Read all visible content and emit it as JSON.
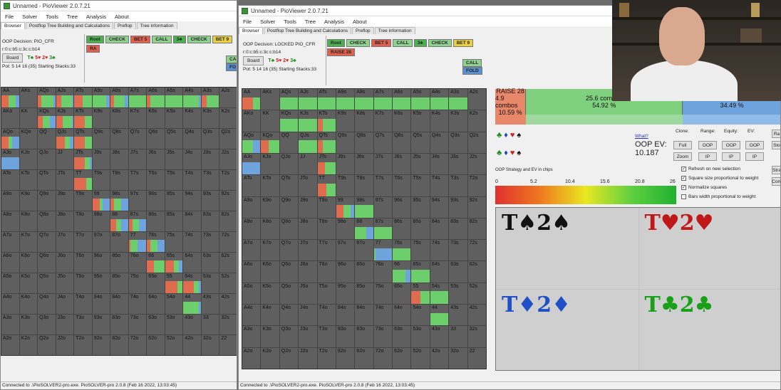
{
  "left_window": {
    "title": "Unnamed - PioViewer 2.0.7.21",
    "menu": [
      "File",
      "Solver",
      "Tools",
      "Tree",
      "Analysis",
      "About"
    ],
    "tabs": [
      "Browser",
      "Postflop Tree Building and Calculations",
      "Preflop",
      "Tree information"
    ],
    "decision": "OOP Decision:  PIO_CFR",
    "line": "r:0:c:b5:c:3c:c:b14",
    "board_label": "Board",
    "board_cards": [
      {
        "t": "T♣",
        "c": "#1a8a1a"
      },
      {
        "t": "5♥",
        "c": "#d02020"
      },
      {
        "t": "2♥",
        "c": "#d02020"
      },
      {
        "t": "3♣",
        "c": "#1a8a1a"
      }
    ],
    "pot": "Pot: 5 14 16 (35) Starting Stacks:33",
    "tree": [
      {
        "t": "Root",
        "c": "#4caf50"
      },
      {
        "t": "CHECK",
        "c": "#8fd18f"
      },
      {
        "t": "BET 5",
        "c": "#e06050"
      },
      {
        "t": "CALL",
        "c": "#8fd18f"
      },
      {
        "t": "3♣",
        "c": "#4caf50"
      },
      {
        "t": "CHECK",
        "c": "#8fd18f"
      },
      {
        "t": "BET 9",
        "c": "#e8d040"
      },
      {
        "t": "RA",
        "c": "#e06050"
      }
    ],
    "tree_extra": [
      {
        "t": "CA",
        "c": "#8fd18f"
      },
      {
        "t": "FO",
        "c": "#5b8fd0"
      }
    ],
    "status": "Connected to .\\PioSOLVER2-pro.exe. PioSOLVER-pro 2.0.8 (Feb 16 2022, 13:03:45)"
  },
  "right_window": {
    "title": "Unnamed - PioViewer 2.0.7.21",
    "menu": [
      "File",
      "Solver",
      "Tools",
      "Tree",
      "Analysis",
      "About"
    ],
    "tabs": [
      "Browser",
      "Postflop Tree Building and Calculations",
      "Preflop",
      "Tree information"
    ],
    "decision": "OOP Decision:  LOCKED PIO_CFR",
    "line": "r:0:c:b5:c:3c:c:b14",
    "board_label": "Board",
    "board_cards": [
      {
        "t": "T♣",
        "c": "#1a8a1a"
      },
      {
        "t": "5♥",
        "c": "#d02020"
      },
      {
        "t": "2♥",
        "c": "#d02020"
      },
      {
        "t": "3♣",
        "c": "#1a8a1a"
      }
    ],
    "pot": "Pot: 5 14 16 (35) Starting Stacks:33",
    "tree": [
      {
        "t": "Root",
        "c": "#4caf50"
      },
      {
        "t": "CHECK",
        "c": "#8fd18f"
      },
      {
        "t": "BET 5",
        "c": "#e06050"
      },
      {
        "t": "CALL",
        "c": "#8fd18f"
      },
      {
        "t": "3♣",
        "c": "#4caf50"
      },
      {
        "t": "CHECK",
        "c": "#8fd18f"
      },
      {
        "t": "BET 9",
        "c": "#e8d040"
      },
      {
        "t": "RAISE 28",
        "c": "#e06050"
      }
    ],
    "tree_extra": [
      {
        "t": "CALL",
        "c": "#8fd18f"
      },
      {
        "t": "FOLD",
        "c": "#5b8fd0"
      }
    ],
    "strategy": [
      {
        "name": "RAISE 28",
        "combos": "4.9 combos",
        "pct": "10.59 %",
        "color": "#e8876a",
        "flex": 10.59
      },
      {
        "name": "",
        "combos": "25.6 combos",
        "pct": "54.92 %",
        "color": "#7fd07f",
        "flex": 54.92
      },
      {
        "name": "",
        "combos": "16.0 combos",
        "pct": "34.49 %",
        "color": "#6fa3de",
        "flex": 34.49
      }
    ],
    "what_link": "What?",
    "oop_ev_label": "OOP EV:",
    "oop_ev_value": "10.187",
    "caption": "OOP Strategy and EV in chips",
    "scale_ticks": [
      "0",
      "5.2",
      "10.4",
      "15.6",
      "20.8",
      "26"
    ],
    "col_headers": [
      "Clone:",
      "Range:",
      "Equity:",
      "EV:"
    ],
    "btn_full": "Full",
    "btn_zoom": "Zoom",
    "btn_oop": "OOP",
    "btn_ip": "IP",
    "btn_ra": "Ra",
    "btn_str": "Stra",
    "btn_com": "Com",
    "btn_sto": "Sto",
    "checkboxes": [
      "Refresh on new selection",
      "Square size proportional to weight",
      "Normalize squares",
      "Bars width proportional to weight"
    ],
    "checked": [
      true,
      true,
      true,
      false
    ],
    "combos": [
      {
        "t": "T♠2♠",
        "c": "#111111"
      },
      {
        "t": "T♥2♥",
        "c": "#c01818"
      },
      {
        "t": "T♦2♦",
        "c": "#2050c8"
      },
      {
        "t": "T♣2♣",
        "c": "#18a018"
      }
    ],
    "status": "Connected to .\\PioSOLVER2-pro.exe. PioSOLVER-pro 2.0.8 (Feb 16 2022, 13:03:45)"
  },
  "suit_rows": [
    [
      "♣",
      "♦",
      "♥",
      "♠"
    ],
    [
      "♣",
      "♦",
      "♥",
      "♠"
    ]
  ],
  "suit_colors": [
    "#1a8a1a",
    "#2040c0",
    "#d02020",
    "#111111"
  ],
  "hand_grid": {
    "ranks": [
      "A",
      "K",
      "Q",
      "J",
      "T",
      "9",
      "8",
      "7",
      "6",
      "5",
      "4",
      "3",
      "2"
    ],
    "colored_cells_left": {
      "AA": [
        40,
        40,
        20
      ],
      "AQ": [
        20,
        70,
        10
      ],
      "AJ": [
        30,
        60,
        10
      ],
      "AT": [
        50,
        50,
        0
      ],
      "A9": [
        0,
        80,
        20
      ],
      "A8": [
        20,
        60,
        20
      ],
      "A7": [
        0,
        100,
        0
      ],
      "A6": [
        20,
        80,
        0
      ],
      "A5": [
        0,
        100,
        0
      ],
      "A4": [
        0,
        90,
        10
      ],
      "A3": [
        30,
        70,
        0
      ],
      "KQ": [
        30,
        40,
        30
      ],
      "KJ": [
        40,
        50,
        10
      ],
      "KT": [
        60,
        40,
        0
      ],
      "QJ": [
        50,
        30,
        20
      ],
      "QT": [
        60,
        40,
        0
      ],
      "JT": [
        60,
        30,
        10
      ],
      "TT": [
        70,
        30,
        0
      ],
      "99": [
        40,
        20,
        40
      ],
      "98": [
        20,
        40,
        40
      ],
      "88": [
        30,
        30,
        40
      ],
      "87": [
        20,
        40,
        40
      ],
      "77": [
        10,
        40,
        50
      ],
      "76": [
        20,
        40,
        40
      ],
      "66": [
        40,
        60,
        0
      ],
      "65": [
        50,
        30,
        20
      ],
      "55": [
        70,
        30,
        0
      ],
      "54": [
        60,
        30,
        10
      ],
      "44": [
        0,
        90,
        10
      ],
      "AQo": [
        40,
        20,
        40
      ],
      "AJo": [
        0,
        0,
        100
      ]
    },
    "colored_cells_right": {
      "AA": [
        60,
        40,
        0
      ],
      "AQ": [
        0,
        100,
        0
      ],
      "AJ": [
        0,
        100,
        0
      ],
      "AT": [
        0,
        100,
        0
      ],
      "A9": [
        0,
        100,
        0
      ],
      "A8": [
        0,
        100,
        0
      ],
      "A7": [
        0,
        100,
        0
      ],
      "A6": [
        0,
        100,
        0
      ],
      "A5": [
        0,
        100,
        0
      ],
      "A4": [
        0,
        100,
        0
      ],
      "A3": [
        0,
        100,
        0
      ],
      "KQ": [
        0,
        100,
        0
      ],
      "KJ": [
        0,
        100,
        0
      ],
      "KT": [
        30,
        70,
        0
      ],
      "QJ": [
        0,
        100,
        0
      ],
      "QT": [
        30,
        70,
        0
      ],
      "JT": [
        40,
        60,
        0
      ],
      "TT": [
        50,
        50,
        0
      ],
      "99": [
        40,
        40,
        20
      ],
      "98": [
        0,
        100,
        0
      ],
      "88": [
        0,
        60,
        40
      ],
      "87": [
        0,
        100,
        0
      ],
      "77": [
        0,
        10,
        90
      ],
      "76": [
        0,
        100,
        0
      ],
      "66": [
        0,
        70,
        30
      ],
      "65": [
        0,
        100,
        0
      ],
      "55": [
        50,
        50,
        0
      ],
      "54": [
        0,
        100,
        0
      ],
      "44": [
        0,
        100,
        0
      ],
      "AQo": [
        0,
        60,
        40
      ],
      "AJo": [
        0,
        0,
        100
      ],
      "KQo": [
        40,
        60,
        0
      ]
    },
    "mix_colors": [
      "#e06c50",
      "#6ccf6c",
      "#6fa3de"
    ]
  }
}
